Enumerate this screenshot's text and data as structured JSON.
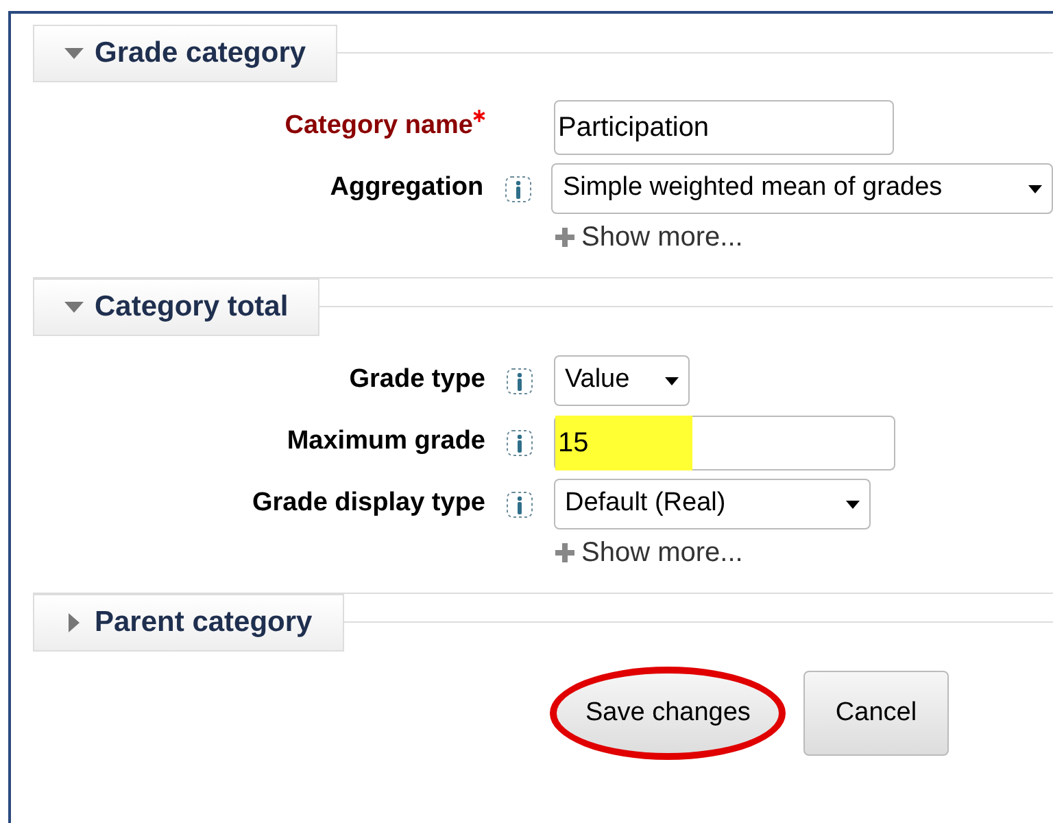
{
  "sections": [
    {
      "title": "Grade category",
      "expanded": true,
      "fields": [
        {
          "kind": "text",
          "label": "Category name",
          "required": true,
          "help": false,
          "value": "Participation",
          "highlighted": false
        },
        {
          "kind": "select",
          "label": "Aggregation",
          "required": false,
          "help": true,
          "value": "Simple weighted mean of grades"
        }
      ],
      "show_more": "Show more..."
    },
    {
      "title": "Category total",
      "expanded": true,
      "fields": [
        {
          "kind": "select",
          "label": "Grade type",
          "required": false,
          "help": true,
          "value": "Value"
        },
        {
          "kind": "text",
          "label": "Maximum grade",
          "required": false,
          "help": true,
          "value": "15",
          "highlighted": true
        },
        {
          "kind": "select",
          "label": "Grade display type",
          "required": false,
          "help": true,
          "value": "Default (Real)"
        }
      ],
      "show_more": "Show more..."
    },
    {
      "title": "Parent category",
      "expanded": false
    }
  ],
  "buttons": [
    {
      "label": "Save changes",
      "circled": true
    },
    {
      "label": "Cancel",
      "circled": false
    }
  ]
}
